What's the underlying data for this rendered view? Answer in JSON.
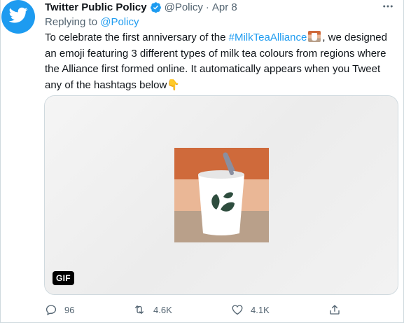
{
  "tweet": {
    "author_name": "Twitter Public Policy",
    "author_handle": "@Policy",
    "separator": "·",
    "date": "Apr 8",
    "replying_prefix": "Replying to",
    "replying_handle": "@Policy",
    "text_part1": "To celebrate the first anniversary of the ",
    "hashtag": "#MilkTeaAlliance",
    "text_part2": ", we designed an emoji featuring 3 different types of milk tea colours from regions where the Alliance first formed online. It automatically appears when you Tweet any of the hashtags below",
    "media_badge": "GIF",
    "counts": {
      "replies": "96",
      "retweets": "4.6K",
      "likes": "4.1K"
    }
  },
  "colors": {
    "brand_blue": "#1d9bf0",
    "band_top": "#cf6a3b",
    "band_middle": "#eab796",
    "band_bottom": "#b9a08a",
    "leaf": "#2e4d3e"
  },
  "icons": {
    "avatar": "twitter-bird-icon",
    "verified": "verified-badge-icon",
    "more": "more-options-icon",
    "reply": "reply-icon",
    "retweet": "retweet-icon",
    "like": "heart-icon",
    "share": "share-icon"
  }
}
